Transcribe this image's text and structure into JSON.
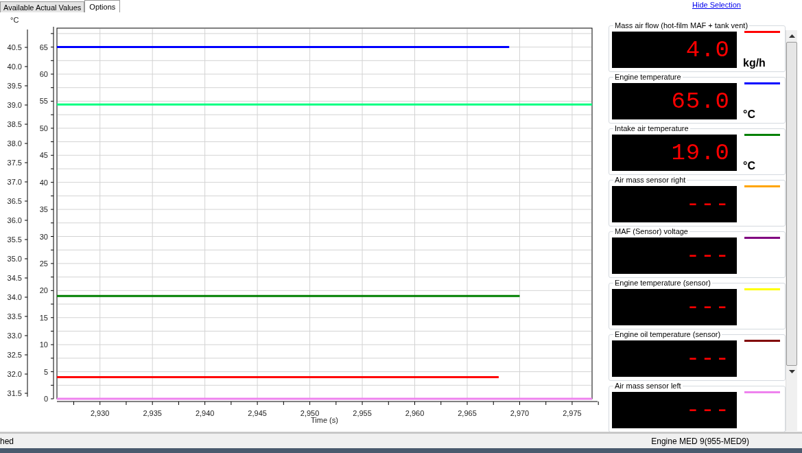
{
  "tabs": [
    {
      "label": "Available Actual Values",
      "selected": false
    },
    {
      "label": "Options",
      "selected": true
    }
  ],
  "hide_selection_link": "Hide Selection",
  "chart": {
    "left_axis": {
      "unit": "°C",
      "ticks": [
        "40.5",
        "40.0",
        "39.5",
        "39.0",
        "38.5",
        "38.0",
        "37.5",
        "37.0",
        "36.5",
        "36.0",
        "35.5",
        "35.0",
        "34.5",
        "34.0",
        "33.5",
        "33.0",
        "32.5",
        "32.0",
        "31.5"
      ]
    },
    "chart_data": {
      "type": "line",
      "xlabel": "Time (s)",
      "grid": true,
      "xlim": [
        2925.9,
        2976.9
      ],
      "ylim": [
        0,
        68.5
      ],
      "xticks": [
        {
          "value": 2930,
          "label": "2,930"
        },
        {
          "value": 2935,
          "label": "2,935"
        },
        {
          "value": 2940,
          "label": "2,940"
        },
        {
          "value": 2945,
          "label": "2,945"
        },
        {
          "value": 2950,
          "label": "2,950"
        },
        {
          "value": 2955,
          "label": "2,955"
        },
        {
          "value": 2960,
          "label": "2,960"
        },
        {
          "value": 2965,
          "label": "2,965"
        },
        {
          "value": 2970,
          "label": "2,970"
        },
        {
          "value": 2975,
          "label": "2,975"
        }
      ],
      "yticks": [
        0,
        5,
        10,
        15,
        20,
        25,
        30,
        35,
        40,
        45,
        50,
        55,
        60,
        65
      ],
      "x": [
        2925.9,
        2968,
        2969,
        2970,
        2976.9
      ],
      "series": [
        {
          "color": "#ff0000",
          "values": [
            4,
            4,
            null,
            null,
            null
          ]
        },
        {
          "color": "#0000ff",
          "values": [
            65,
            65,
            65,
            null,
            null
          ]
        },
        {
          "color": "#008000",
          "values": [
            19,
            19,
            19,
            19,
            null
          ]
        },
        {
          "color": "#00ff7f",
          "values": [
            54.4,
            54.4,
            54.4,
            54.4,
            54.4
          ]
        },
        {
          "color": "#ee82ee",
          "values": [
            0,
            0,
            0,
            0,
            0
          ]
        }
      ]
    }
  },
  "gauges": [
    {
      "title": "Mass air flow (hot-film MAF + tank vent)",
      "value": "4.0",
      "unit": "kg/h",
      "color": "#ff0000"
    },
    {
      "title": "Engine temperature",
      "value": "65.0",
      "unit": "°C",
      "color": "#0000ff"
    },
    {
      "title": "Intake air temperature",
      "value": "19.0",
      "unit": "°C",
      "color": "#008000"
    },
    {
      "title": "Air mass sensor right",
      "value": "---",
      "color": "#ffa500"
    },
    {
      "title": "MAF (Sensor) voltage",
      "value": "---",
      "color": "#800080"
    },
    {
      "title": "Engine temperature (sensor)",
      "value": "---",
      "color": "#ffff00"
    },
    {
      "title": "Engine oil temperature (sensor)",
      "value": "---",
      "color": "#800000"
    },
    {
      "title": "Air mass sensor left",
      "value": "---",
      "color": "#ee82ee"
    }
  ],
  "status_bar": {
    "left": "hed",
    "right": "Engine MED 9(955-MED9)"
  }
}
